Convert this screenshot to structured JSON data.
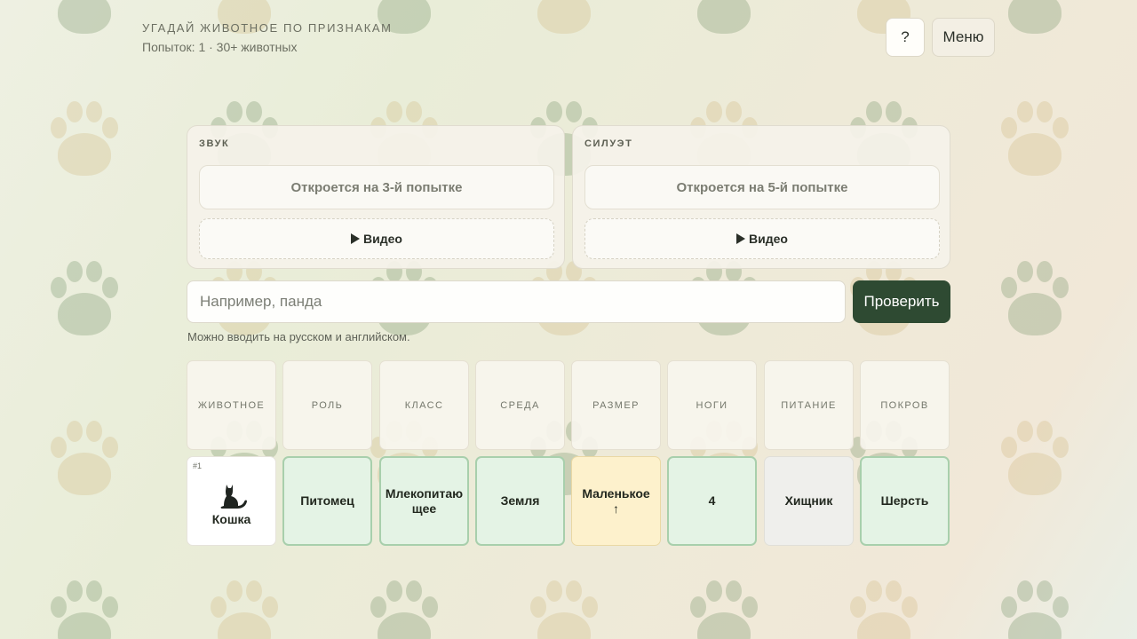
{
  "header": {
    "title": "УГАДАЙ ЖИВОТНОЕ ПО ПРИЗНАКАМ",
    "subtitle": "Попыток: 1 · 30+ животных",
    "help_label": "?",
    "menu_label": "Меню"
  },
  "clues": [
    {
      "title": "ЗВУК",
      "locked_text": "Откроется на 3-й попытке",
      "video_label": "Видео"
    },
    {
      "title": "СИЛУЭТ",
      "locked_text": "Откроется на 5-й попытке",
      "video_label": "Видео"
    }
  ],
  "guess": {
    "placeholder": "Например, панда",
    "value": "",
    "submit_label": "Проверить",
    "hint": "Можно вводить на русском и английском."
  },
  "columns": [
    "ЖИВОТНОЕ",
    "РОЛЬ",
    "КЛАСС",
    "СРЕДА",
    "РАЗМЕР",
    "НОГИ",
    "ПИТАНИЕ",
    "ПОКРОВ"
  ],
  "guesses": [
    {
      "number": "#1",
      "animal": "Кошка",
      "animal_icon": "cat-silhouette-icon",
      "cells": [
        {
          "value": "Питомец",
          "status": "match"
        },
        {
          "value": "Млекопитающее",
          "status": "match"
        },
        {
          "value": "Земля",
          "status": "match"
        },
        {
          "value": "Маленькое",
          "arrow": "↑",
          "status": "close"
        },
        {
          "value": "4",
          "status": "match"
        },
        {
          "value": "Хищник",
          "status": "miss"
        },
        {
          "value": "Шерсть",
          "status": "match"
        }
      ]
    }
  ],
  "colors": {
    "accent": "#2e4a32",
    "match": "#e4f3e5",
    "close": "#fdf1cc",
    "miss": "#efefec"
  }
}
